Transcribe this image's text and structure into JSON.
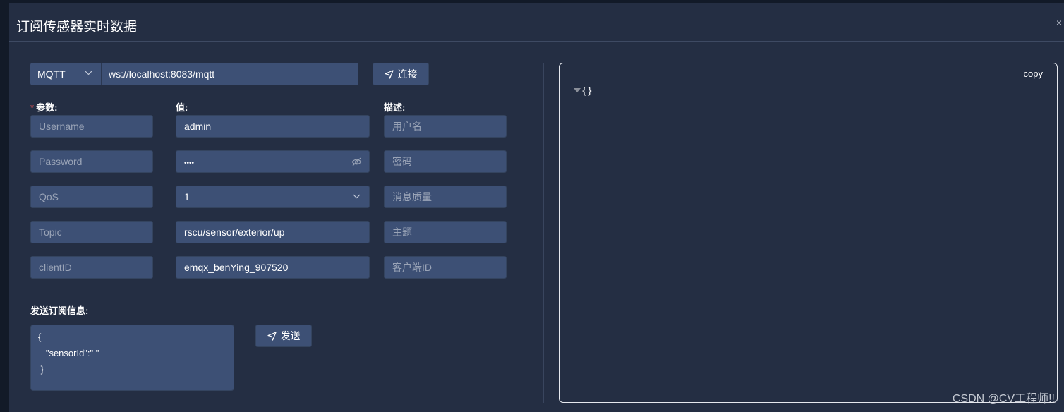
{
  "dialog": {
    "title": "订阅传感器实时数据",
    "close_icon": "close-icon"
  },
  "connection": {
    "protocol": "MQTT",
    "url": "ws://localhost:8083/mqtt",
    "connect_label": "连接",
    "connect_icon": "send-arrow-icon"
  },
  "columns": {
    "param": "参数:",
    "value": "值:",
    "desc": "描述:"
  },
  "rows": [
    {
      "param": "Username",
      "value": "admin",
      "desc": "用户名",
      "type": "text"
    },
    {
      "param": "Password",
      "value": "••••",
      "desc": "密码",
      "type": "password"
    },
    {
      "param": "QoS",
      "value": "1",
      "desc": "消息质量",
      "type": "select"
    },
    {
      "param": "Topic",
      "value": "rscu/sensor/exterior/up",
      "desc": "主题",
      "type": "text"
    },
    {
      "param": "clientID",
      "value": "emqx_benYing_907520",
      "desc": "客户端ID",
      "type": "text"
    }
  ],
  "subscribe": {
    "label": "发送订阅信息:",
    "message": "{\n   \"sensorId\":\" \"\n }",
    "send_label": "发送"
  },
  "json_viewer": {
    "copy_label": "copy",
    "content": "{}"
  },
  "watermark": "CSDN @CV工程师!!",
  "colors": {
    "background": "#242e43",
    "input": "#3d5075",
    "required": "#e05555"
  }
}
